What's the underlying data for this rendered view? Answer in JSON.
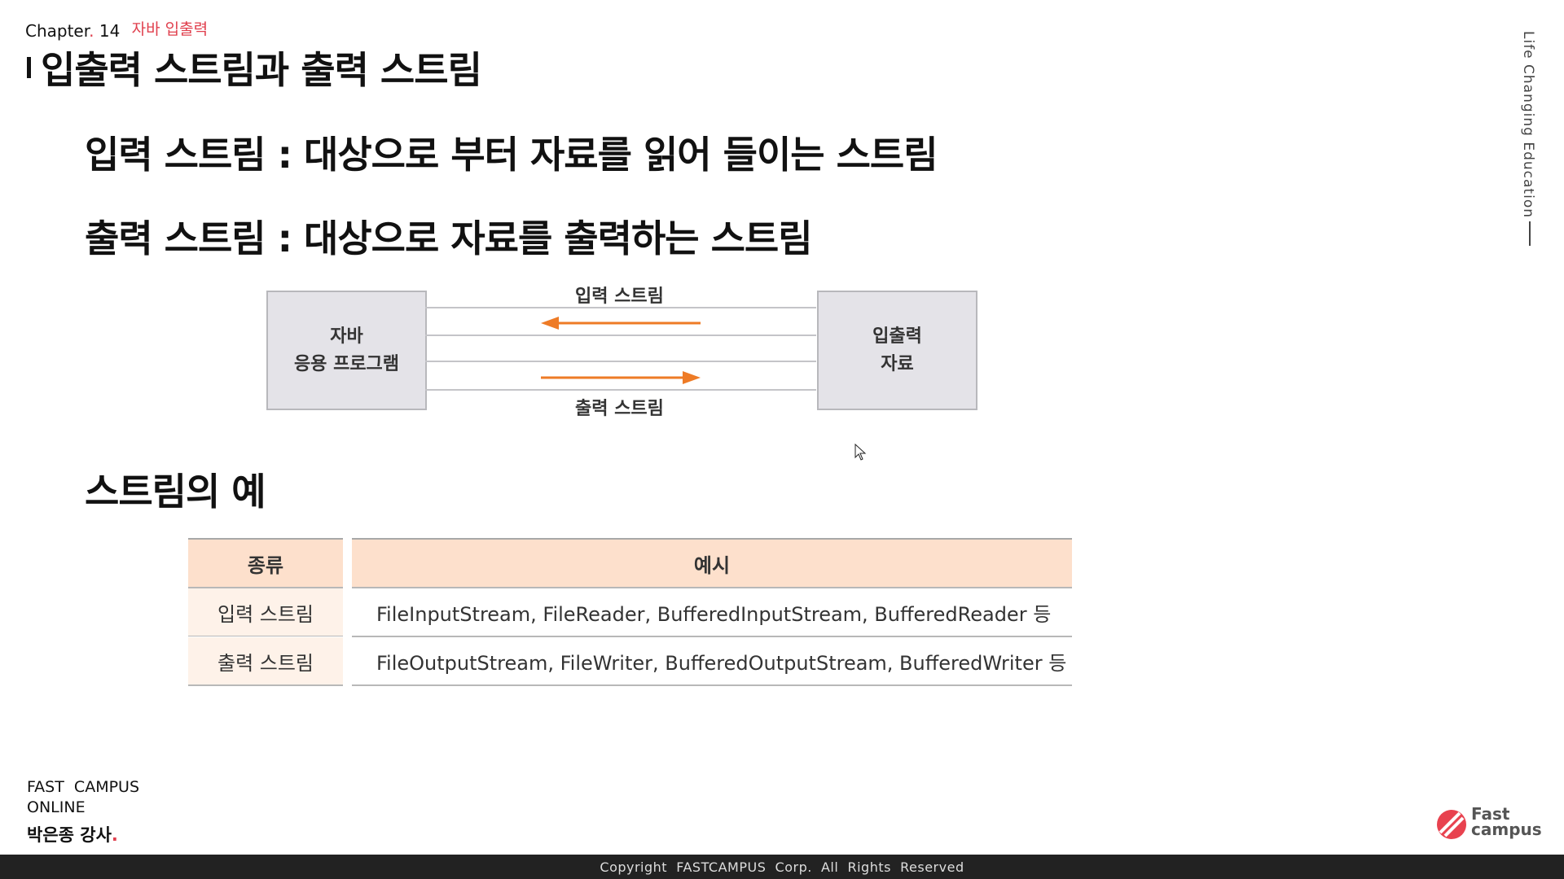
{
  "header": {
    "chapter_label": "Chapter",
    "chapter_dot": ".",
    "chapter_number": "14",
    "chapter_topic": "자바 입출력",
    "title": "입출력 스트림과 출력 스트림"
  },
  "definitions": {
    "input": "입력 스트림 : 대상으로 부터 자료를 읽어 들이는 스트림",
    "output": "출력 스트림 : 대상으로 자료를 출력하는 스트림"
  },
  "diagram": {
    "left_box": [
      "자바",
      "응용 프로그램"
    ],
    "right_box": [
      "입출력",
      "자료"
    ],
    "top_label": "입력 스트림",
    "bottom_label": "출력 스트림",
    "arrow_color": "#ee7b26"
  },
  "examples": {
    "title": "스트림의 예",
    "headers": [
      "종류",
      "예시"
    ],
    "rows": [
      [
        "입력 스트림",
        "FileInputStream, FileReader, BufferedInputStream, BufferedReader 등"
      ],
      [
        "출력 스트림",
        "FileOutputStream, FileWriter, BufferedOutputStream, BufferedWriter 등"
      ]
    ]
  },
  "side_text": "Life Changing Education",
  "footer": {
    "org_line1": "FAST  CAMPUS",
    "org_line2": "ONLINE",
    "instructor": "박은종 강사",
    "instructor_dot": ".",
    "logo_text_line1": "Fast",
    "logo_text_line2": "campus",
    "copyright": "Copyright  FASTCAMPUS  Corp.  All  Rights  Reserved"
  },
  "colors": {
    "accent_red": "#e0404e",
    "table_header_bg": "#fde0cc",
    "table_kind_bg": "#fef2e9",
    "box_bg": "#e4e3e8"
  }
}
